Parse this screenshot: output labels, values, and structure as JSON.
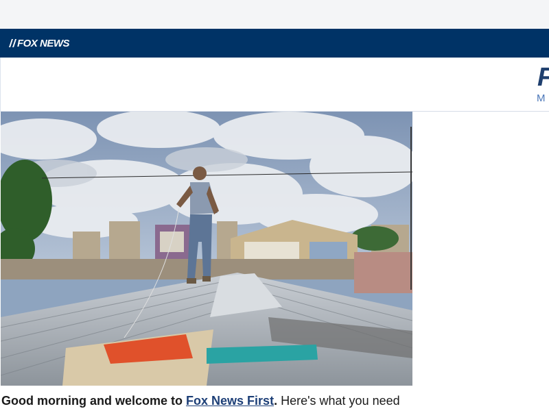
{
  "header": {
    "logo_text": "FOX NEWS",
    "background_color": "#003366"
  },
  "masthead": {
    "title_fragment": "F",
    "subtitle_fragment": "M",
    "title_color": "#1f3f6e"
  },
  "hero": {
    "image": "man-standing-on-corrugated-metal-roof"
  },
  "intro": {
    "greeting": "Good morning and welcome to",
    "link_text": "Fox News First",
    "period": ".",
    "rest": " Here's what you need"
  }
}
